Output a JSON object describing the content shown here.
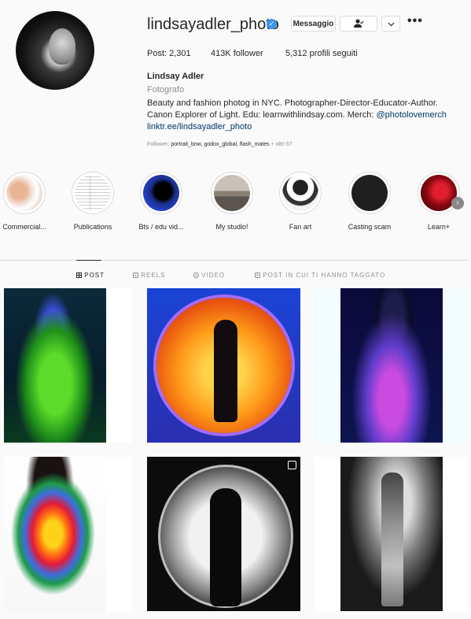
{
  "profile": {
    "username": "lindsayadler_photo",
    "verified_mark": "✓",
    "buttons": {
      "message": "Messaggio",
      "follow_icon": "person-check-icon",
      "dropdown": "⌄",
      "more": "•••"
    },
    "stats": {
      "posts": "Post: 2,301",
      "followers": "413K follower",
      "following": "5,312 profili seguiti"
    },
    "full_name": "Lindsay Adler",
    "category": "Fotografo",
    "bio_line1": "Beauty and fashion photog in NYC. Photographer-Director-Educator-Author.",
    "bio_line2_pre": "Canon Explorer of Light. Edu: learnwithlindsay.com. Merch: ",
    "bio_mention": "@photolovemerch",
    "bio_link": "linktr.ee/lindsayadler_photo",
    "followed_by_prefix": "Follower: ",
    "followed_by_names": "portrait_bnw, godox_global, flash_mates",
    "followed_by_suffix": " + altri 67"
  },
  "highlights": [
    {
      "label": "Commercial..."
    },
    {
      "label": "Publications"
    },
    {
      "label": "Bts / edu vid..."
    },
    {
      "label": "My studio!"
    },
    {
      "label": "Fan art"
    },
    {
      "label": "Casting scam"
    },
    {
      "label": "Learn+"
    }
  ],
  "highlights_next": "›",
  "tabs": [
    {
      "label": "POST",
      "icon": "grid-icon"
    },
    {
      "label": "REELS",
      "icon": "reels-icon"
    },
    {
      "label": "VIDEO",
      "icon": "video-icon"
    },
    {
      "label": "POST IN CUI TI HANNO TAGGATO",
      "icon": "tag-icon"
    }
  ],
  "colors": {
    "accent": "#3897f0",
    "link": "#00376b",
    "muted": "#8e8e8e",
    "border": "#dbdbdb"
  }
}
